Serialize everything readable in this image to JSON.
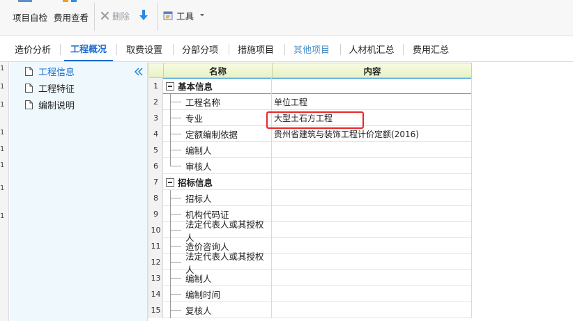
{
  "toolbar": {
    "project_check": "项目自检",
    "fee_view": "费用查看",
    "delete": "删除",
    "tools": "工具"
  },
  "tabs": [
    {
      "label": "造价分析"
    },
    {
      "label": "工程概况"
    },
    {
      "label": "取费设置"
    },
    {
      "label": "分部分项"
    },
    {
      "label": "措施项目"
    },
    {
      "label": "其他项目"
    },
    {
      "label": "人材机汇总"
    },
    {
      "label": "费用汇总"
    }
  ],
  "active_tab": "工程概况",
  "tree": {
    "items": [
      {
        "label": "工程信息"
      },
      {
        "label": "工程特征"
      },
      {
        "label": "编制说明"
      }
    ],
    "active_item": "工程信息"
  },
  "grid": {
    "columns": [
      "名称",
      "内容"
    ],
    "rows": [
      {
        "num": "1",
        "name": "基本信息",
        "value": ""
      },
      {
        "num": "2",
        "name": "工程名称",
        "value": "单位工程"
      },
      {
        "num": "3",
        "name": "专业",
        "value": "大型土石方工程"
      },
      {
        "num": "4",
        "name": "定额编制依据",
        "value": "贵州省建筑与装饰工程计价定额(2016)"
      },
      {
        "num": "5",
        "name": "编制人",
        "value": ""
      },
      {
        "num": "6",
        "name": "审核人",
        "value": ""
      },
      {
        "num": "7",
        "name": "招标信息",
        "value": ""
      },
      {
        "num": "8",
        "name": "招标人",
        "value": ""
      },
      {
        "num": "9",
        "name": "机构代码证",
        "value": ""
      },
      {
        "num": "10",
        "name": "法定代表人或其授权人",
        "value": ""
      },
      {
        "num": "11",
        "name": "造价咨询人",
        "value": ""
      },
      {
        "num": "12",
        "name": "法定代表人或其授权人",
        "value": ""
      },
      {
        "num": "13",
        "name": "编制人",
        "value": ""
      },
      {
        "num": "14",
        "name": "编制时间",
        "value": ""
      },
      {
        "num": "15",
        "name": "复核人",
        "value": ""
      }
    ]
  },
  "gutter_marks": [
    "1",
    "1",
    "1",
    "1",
    "1",
    "1",
    "1",
    "1"
  ],
  "colors": {
    "accent": "#1e6fcf",
    "highlight_box": "#e8262a",
    "tree_bg": "#eef8fd",
    "header_bg": "#eef5d3"
  }
}
